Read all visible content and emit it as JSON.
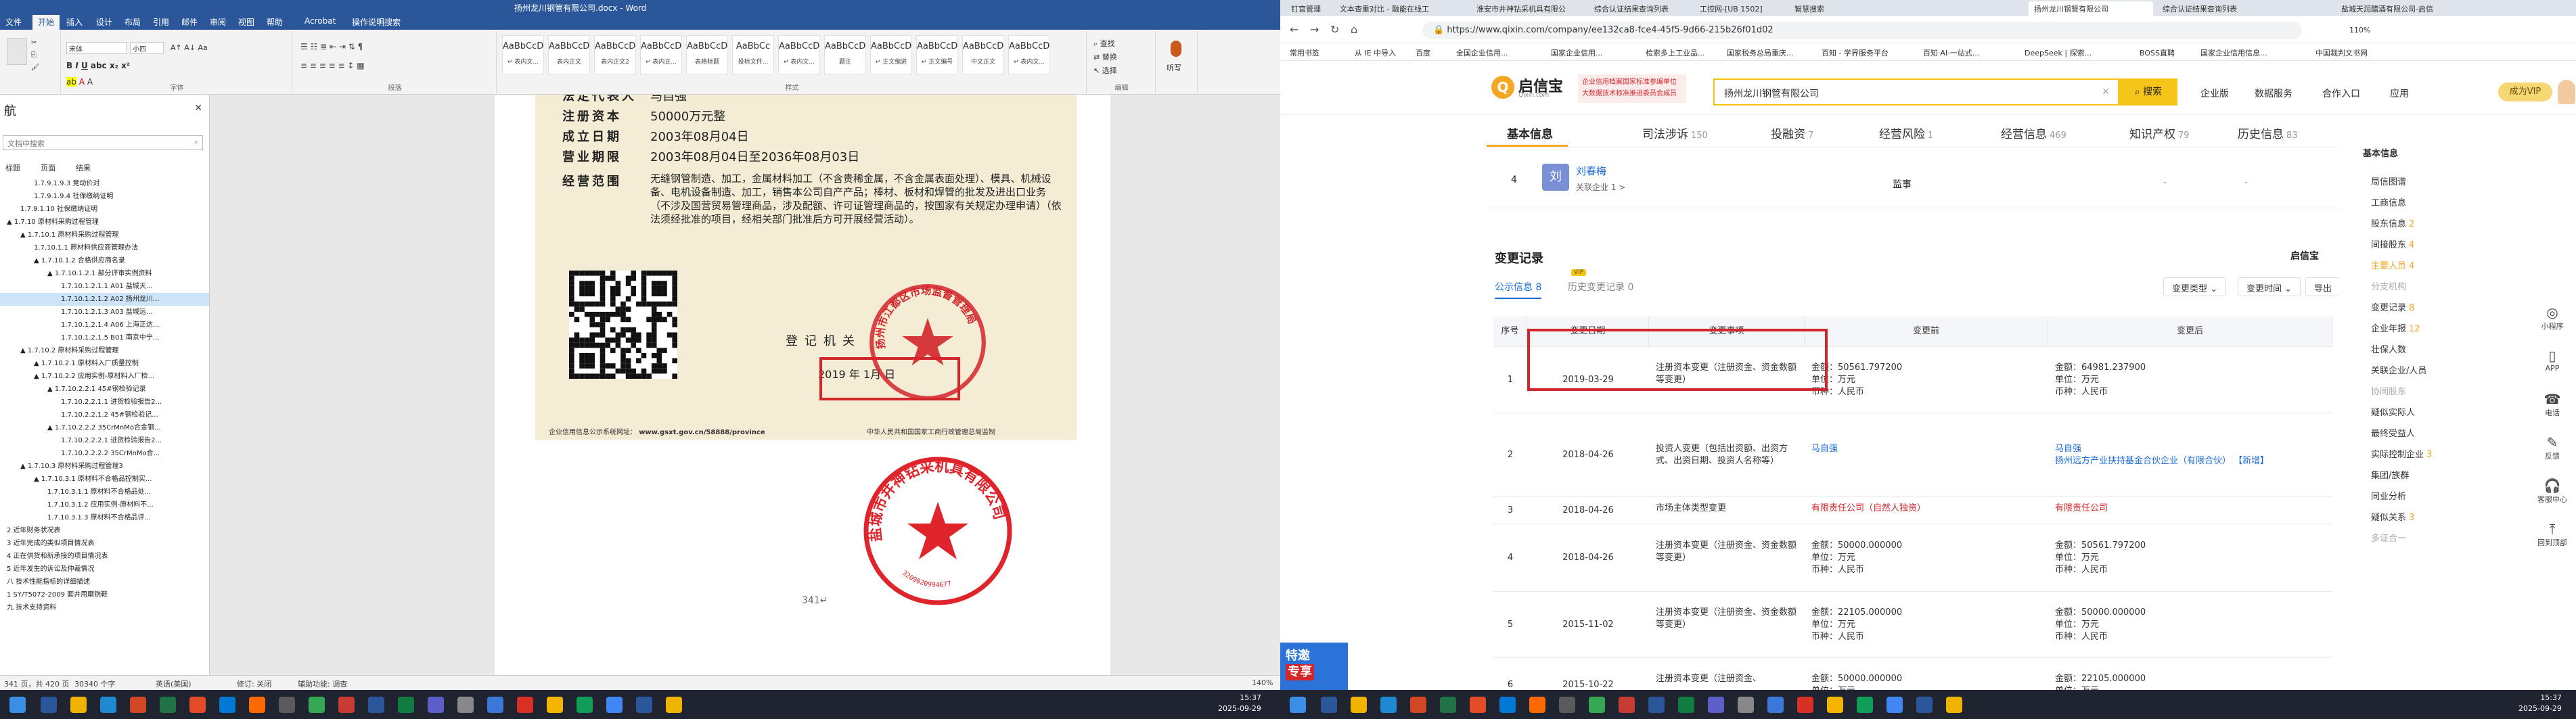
{
  "word": {
    "title": "扬州龙川钢管有限公司.docx - Word",
    "tabs": [
      "文件",
      "开始",
      "插入",
      "设计",
      "布局",
      "引用",
      "邮件",
      "审阅",
      "视图",
      "帮助",
      "Acrobat",
      "操作说明搜索"
    ],
    "active_tab": "开始",
    "ribbon": {
      "font_name": "宋体",
      "font_size": "小四",
      "group_font": "字体",
      "group_paragraph": "段落",
      "group_styles": "样式",
      "group_edit": "编辑",
      "styles": [
        {
          "preview": "AaBbCcDd",
          "name": "↵ 表内文..."
        },
        {
          "preview": "AaBbCcDd",
          "name": "表内正文"
        },
        {
          "preview": "AaBbCcDd",
          "name": "表内正文2"
        },
        {
          "preview": "AaBbCcDd",
          "name": "↵ 表内正..."
        },
        {
          "preview": "AaBbCcDd",
          "name": "表格标题"
        },
        {
          "preview": "AaBbCc",
          "name": "投标文件..."
        },
        {
          "preview": "AaBbCcD",
          "name": "↵ 表内文..."
        },
        {
          "preview": "AaBbCcD",
          "name": "题注"
        },
        {
          "preview": "AaBbCcDd",
          "name": "↵ 正文缩进"
        },
        {
          "preview": "AaBbCcDd",
          "name": "↵ 正文编号"
        },
        {
          "preview": "AaBbCcD",
          "name": "中文正文"
        },
        {
          "preview": "AaBbCcD",
          "name": "↵ 表内文..."
        }
      ],
      "find": "查找",
      "replace": "替换",
      "select": "选择",
      "dictate": "听写"
    },
    "nav": {
      "title": "航",
      "search_placeholder": "文档中搜索",
      "subtabs": [
        "标题",
        "页面",
        "结果"
      ],
      "items": [
        {
          "text": "1.7.9.1.9.3 竞动价对",
          "indent": 2
        },
        {
          "text": "1.7.9.1.9.4 社保缴纳证明",
          "indent": 2
        },
        {
          "text": "1.7.9.1.10 社保缴纳证明",
          "indent": 1
        },
        {
          "text": "▲ 1.7.10 原材料采购过程管理",
          "indent": 0
        },
        {
          "text": "▲ 1.7.10.1 原材料采购过程管理",
          "indent": 1
        },
        {
          "text": "1.7.10.1.1 原材料供应商管理办法",
          "indent": 2
        },
        {
          "text": "▲ 1.7.10.1.2 合格供应商名录",
          "indent": 2
        },
        {
          "text": "▲ 1.7.10.1.2.1 部分评审实例资料",
          "indent": 3
        },
        {
          "text": "1.7.10.1.2.1.1 A01 盐城天...",
          "indent": 4
        },
        {
          "text": "1.7.10.1.2.1.2 A02 扬州龙川...",
          "indent": 4,
          "sel": true
        },
        {
          "text": "1.7.10.1.2.1.3 A03 盐城远...",
          "indent": 4
        },
        {
          "text": "1.7.10.1.2.1.4 A06 上海正达...",
          "indent": 4
        },
        {
          "text": "1.7.10.1.2.1.5 B01 南京中宁...",
          "indent": 4
        },
        {
          "text": "▲ 1.7.10.2 原材料采购过程管理",
          "indent": 1
        },
        {
          "text": "▲ 1.7.10.2.1 原材料入厂质量控制",
          "indent": 2
        },
        {
          "text": "▲ 1.7.10.2.2 应用实例-原材料入厂检...",
          "indent": 2
        },
        {
          "text": "▲ 1.7.10.2.2.1 45#钢检验记录",
          "indent": 3
        },
        {
          "text": "1.7.10.2.2.1.1 进货检验报告2...",
          "indent": 4
        },
        {
          "text": "1.7.10.2.2.1.2 45#钢检验记...",
          "indent": 4
        },
        {
          "text": "▲ 1.7.10.2.2.2 35CrMnMo合金钢...",
          "indent": 3
        },
        {
          "text": "1.7.10.2.2.2.1 进货检验报告2...",
          "indent": 4
        },
        {
          "text": "1.7.10.2.2.2.2 35CrMnMo合...",
          "indent": 4
        },
        {
          "text": "▲ 1.7.10.3 原材料采购过程管理3",
          "indent": 1
        },
        {
          "text": "▲ 1.7.10.3.1 原材料不合格品控制实...",
          "indent": 2
        },
        {
          "text": "1.7.10.3.1.1 原材料不合格品处...",
          "indent": 3
        },
        {
          "text": "1.7.10.3.1.2 应用实例-原材料不...",
          "indent": 3
        },
        {
          "text": "1.7.10.3.1.3 原材料不合格品评...",
          "indent": 3
        },
        {
          "text": "2 近年财务状况表",
          "indent": 0
        },
        {
          "text": "3 近年完成的类似项目情况表",
          "indent": 0
        },
        {
          "text": "4 正在供货和新承接的项目情况表",
          "indent": 0
        },
        {
          "text": "5 近年发生的诉讼及仲裁情况",
          "indent": 0
        },
        {
          "text": "八 技术性能指标的详细描述",
          "indent": 0
        },
        {
          "text": "1 SY/T5072-2009 套井用磨铣鞋",
          "indent": 0
        },
        {
          "text": "九 技术支持资料",
          "indent": 0
        }
      ]
    },
    "certificate": {
      "rows": [
        {
          "k": "法定代表人",
          "v": "马自强"
        },
        {
          "k": "注册资本",
          "v": "50000万元整"
        },
        {
          "k": "成立日期",
          "v": "2003年08月04日"
        },
        {
          "k": "营业期限",
          "v": "2003年08月04日至2036年08月03日"
        }
      ],
      "scope_label": "经营范围",
      "scope_text": "无缝钢管制造、加工，金属材料加工（不含贵稀金属，不含金属表面处理）、模具、机械设备、电机设备制造、加工，销售本公司自产产品；棒材、板材和焊管的批发及进出口业务（不涉及国营贸易管理商品，涉及配额、许可证管理商品的，按国家有关规定办理申请）（依法须经批准的项目，经相关部门批准后方可开展经营活动）。",
      "authority": "登记机关",
      "date": "2019 年  1月    日",
      "footer_left": "企业信用信息公示系统网址：",
      "footer_url": "www.gsxt.gov.cn/58888/province",
      "footer_right": "中华人民共和国国家工商行政管理总局监制",
      "stamp1_text": "扬州市江都区市场监督管理局",
      "stamp2_text": "盐城市井神钻采机具有限公司",
      "stamp2_num": "3209020994677"
    },
    "page_number": "341↵",
    "status": {
      "page": "341 页，共 420 页",
      "words": "30340 个字",
      "lang": "英语(美国)",
      "revise": "修订: 关闭",
      "access": "辅助功能: 调查",
      "zoom": "140%"
    }
  },
  "browser": {
    "tabs": [
      {
        "text": "钉宫管理",
        "active": false
      },
      {
        "text": "文本查重对比 - 融能在线工",
        "active": false
      },
      {
        "text": "淮安市井神钻采机具有限公",
        "active": false
      },
      {
        "text": "综合认证结果查询列表",
        "active": false
      },
      {
        "text": "工控网-[UB 1502]",
        "active": false
      },
      {
        "text": "智慧搜索",
        "active": false
      },
      {
        "text": "扬州龙川钢管有限公司",
        "active": true
      },
      {
        "text": "综合认证结果查询列表",
        "active": false
      },
      {
        "text": "盐城天润醋酒有限公司-启信",
        "active": false
      }
    ],
    "url": "https://www.qixin.com/company/ee132ca8-fce4-45f5-9d66-215b26f01d02",
    "zoom": "110%",
    "bookmarks": [
      "常用书签",
      "从 IE 中导入",
      "百度",
      "全国企业信用...",
      "国家企业信用...",
      "检索多上工业品...",
      "国家税务总局重庆...",
      "百知 - 学界服务平台",
      "百知·AI·一站式...",
      "DeepSeek | 探索...",
      "BOSS直聘",
      "国家企业信用信息...",
      "中国裁判文书网"
    ],
    "qixin": {
      "logo": "启信宝",
      "logo_sub": "Qixin.com",
      "ad": "企业信用档案国家标准参编单位 大数据技术标准推进委员会成员",
      "search_value": "扬州龙川钢管有限公司",
      "search_btn": "搜索",
      "topnav": [
        "企业版",
        "数据服务",
        "合作入口",
        "应用"
      ],
      "vip": "成为VIP",
      "maintabs": [
        {
          "label": "基本信息",
          "count": "",
          "active": true
        },
        {
          "label": "司法涉诉",
          "count": "150",
          "active": false
        },
        {
          "label": "投融资",
          "count": "7",
          "active": false
        },
        {
          "label": "经营风险",
          "count": "1",
          "active": false
        },
        {
          "label": "经营信息",
          "count": "469",
          "active": false
        },
        {
          "label": "知识产权",
          "count": "79",
          "active": false
        },
        {
          "label": "历史信息",
          "count": "83",
          "active": false
        }
      ],
      "person": {
        "num": "4",
        "avatar": "刘",
        "name": "刘春梅",
        "sub": "关联企业 1 >",
        "role": "监事",
        "d1": "-",
        "d2": "-"
      },
      "section_title": "变更记录",
      "brand": "启信宝",
      "subtab1": "公示信息 8",
      "subtab2": "历史变更记录 0",
      "vip_badge": "VIP",
      "filters": [
        "变更类型 ⌄",
        "变更时间 ⌄",
        "导出"
      ],
      "table_headers": [
        "序号",
        "变更日期",
        "变更事项",
        "变更前",
        "变更后"
      ],
      "rows": [
        {
          "no": "1",
          "date": "2019-03-29",
          "item": "注册资本变更（注册资金、资金数额等变更）",
          "before": [
            "金额：50561.797200",
            "单位：万元",
            "币种：人民币"
          ],
          "after": [
            "金额：64981.237900",
            "单位：万元",
            "币种：人民币"
          ]
        },
        {
          "no": "2",
          "date": "2018-04-26",
          "item": "投资人变更（包括出资额、出资方式、出资日期、投资人名称等）",
          "before": [
            "马自强"
          ],
          "after": [
            "马自强",
            "扬州远方产业扶持基金合伙企业（有限合伙） 【新增】"
          ]
        },
        {
          "no": "3",
          "date": "2018-04-26",
          "item": "市场主体类型变更",
          "before": [
            "有限责任公司（自然人独资）"
          ],
          "after": [
            "有限责任公司"
          ]
        },
        {
          "no": "4",
          "date": "2018-04-26",
          "item": "注册资本变更（注册资金、资金数额等变更）",
          "before": [
            "金额：50000.000000",
            "单位：万元",
            "币种：人民币"
          ],
          "after": [
            "金额：50561.797200",
            "单位：万元",
            "币种：人民币"
          ]
        },
        {
          "no": "5",
          "date": "2015-11-02",
          "item": "注册资本变更（注册资金、资金数额等变更）",
          "before": [
            "金额：22105.000000",
            "单位：万元",
            "币种：人民币"
          ],
          "after": [
            "金额：50000.000000",
            "单位：万元",
            "币种：人民币"
          ]
        },
        {
          "no": "6",
          "date": "2015-10-22",
          "item": "注册资本变更（注册资金、",
          "before": [
            "金额：50000.000000",
            "单位：万元"
          ],
          "after": [
            "金额：22105.000000",
            "单位：万元"
          ]
        }
      ],
      "side": {
        "title": "基本信息",
        "items": [
          {
            "t": "局信图谱",
            "c": ""
          },
          {
            "t": "工商信息",
            "c": ""
          },
          {
            "t": "股东信息",
            "c": "2"
          },
          {
            "t": "间接股东",
            "c": "4"
          },
          {
            "t": "主要人员",
            "c": "4",
            "hl": true
          },
          {
            "t": "分支机构",
            "c": "",
            "dim": true
          },
          {
            "t": "变更记录",
            "c": "8"
          },
          {
            "t": "企业年报",
            "c": "12"
          },
          {
            "t": "壮保人数",
            "c": ""
          },
          {
            "t": "关联企业/人员",
            "c": ""
          },
          {
            "t": "协同股东",
            "c": "",
            "dim": true
          },
          {
            "t": "疑似实际人",
            "c": ""
          },
          {
            "t": "最终受益人",
            "c": ""
          },
          {
            "t": "实际控制企业",
            "c": "3"
          },
          {
            "t": "集团/族群",
            "c": ""
          },
          {
            "t": "同业分析",
            "c": ""
          },
          {
            "t": "疑似关系",
            "c": "3"
          },
          {
            "t": "多证合一",
            "c": "",
            "dim": true
          }
        ]
      },
      "toolbar": [
        "小程序",
        "APP",
        "电话",
        "反馈",
        "客服中心",
        "回到顶部"
      ],
      "promo": [
        "特邀",
        "专享"
      ]
    }
  },
  "taskbar": {
    "time": "15:37",
    "date": "2025-09-29"
  }
}
